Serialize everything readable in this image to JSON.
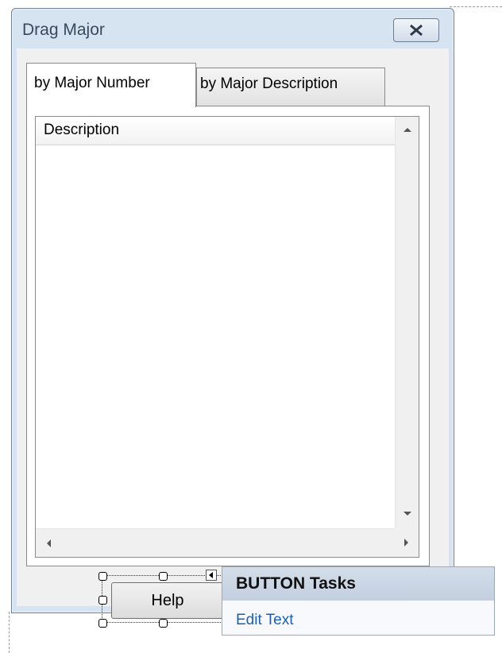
{
  "window": {
    "title": "Drag Major"
  },
  "tabs": [
    {
      "label": "by Major Number",
      "active": true
    },
    {
      "label": "by Major Description",
      "active": false
    }
  ],
  "list": {
    "columns": [
      "Description"
    ]
  },
  "button": {
    "label": "Help"
  },
  "tasks_panel": {
    "title": "BUTTON Tasks",
    "link": "Edit Text"
  },
  "colors": {
    "title_bar": "#d6e3f1",
    "link": "#1c5fb8",
    "tasks_header": "#c8d4e3"
  }
}
